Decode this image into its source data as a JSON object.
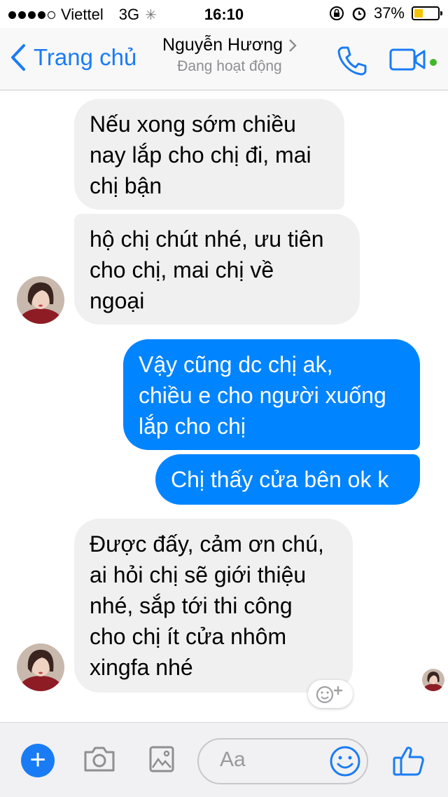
{
  "status": {
    "carrier": "Viettel",
    "network": "3G",
    "time": "16:10",
    "battery": "37%",
    "battery_level": 0.37
  },
  "nav": {
    "back_label": "Trang chủ",
    "contact_name": "Nguyễn Hương",
    "contact_status": "Đang hoạt động"
  },
  "messages": [
    {
      "direction": "incoming",
      "lines": [
        "Nếu xong sớm chiều",
        "nay lắp cho chị đi, mai",
        "chị bận"
      ]
    },
    {
      "direction": "incoming",
      "lines": [
        "hộ chị chút nhé, ưu tiên",
        "cho chị, mai chị về",
        "ngoại"
      ]
    },
    {
      "direction": "outgoing",
      "lines": [
        "Vậy cũng dc chị ak,",
        "chiều e cho người xuống",
        "lắp cho chị"
      ]
    },
    {
      "direction": "outgoing",
      "lines": [
        "Chị thấy cửa bên ok k"
      ]
    },
    {
      "direction": "incoming",
      "lines": [
        "Được đấy, cảm ơn chú,",
        "ai hỏi chị sẽ giới thiệu",
        "nhé, sắp tới thi công",
        "cho chị ít cửa nhôm",
        "xingfa nhé"
      ]
    }
  ],
  "composer": {
    "placeholder": "Aa"
  },
  "colors": {
    "accent": "#1a7cf4",
    "outgoing_bubble": "#0084ff",
    "incoming_bubble": "#f1f0f0",
    "online": "#42b72a"
  },
  "icons": [
    "back-chevron-icon",
    "chevron-right-icon",
    "phone-icon",
    "video-icon",
    "plus-icon",
    "camera-icon",
    "gallery-icon",
    "emoji-icon",
    "thumbs-up-icon",
    "add-reaction-icon"
  ]
}
